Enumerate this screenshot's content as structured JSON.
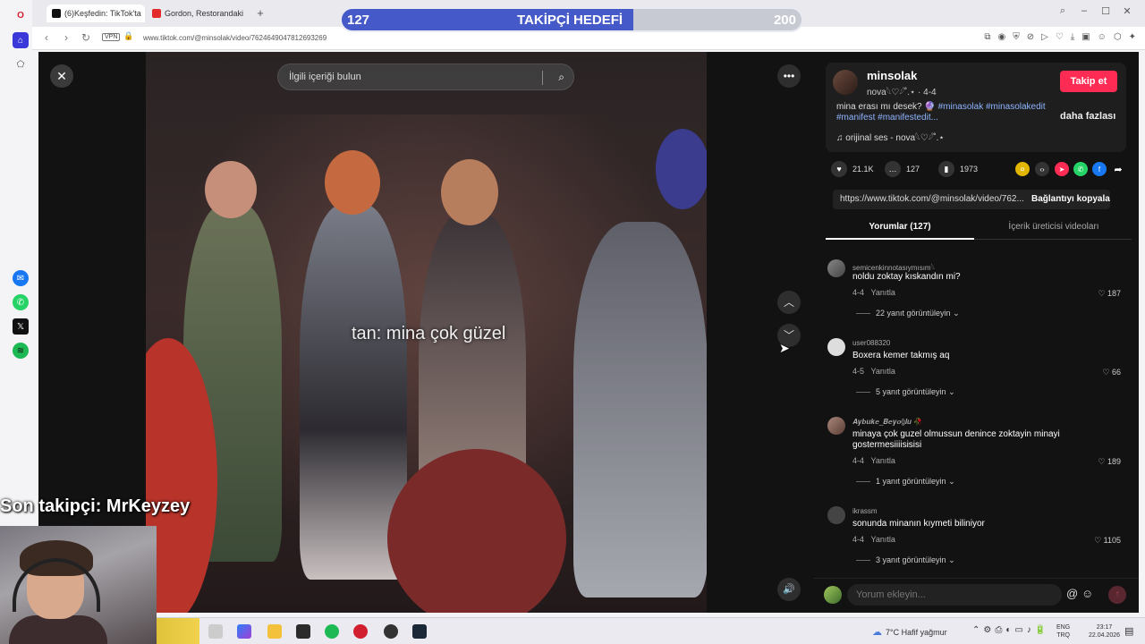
{
  "browser": {
    "tabs": [
      {
        "label": "(6)Keşfedin: TikTok'ta",
        "active": true
      },
      {
        "label": "Gordon, Restorandaki M...",
        "active": false
      }
    ],
    "new_tab": "+",
    "url": "www.tiktok.com/@minsolak/video/7624649047812693269",
    "vpn": "VPN"
  },
  "overlay": {
    "goal_current": "127",
    "goal_label": "TAKİPÇİ HEDEFİ",
    "goal_target": "200",
    "goal_progress": 0.635,
    "last_follower": "Son takipçi: MrKeyzey"
  },
  "video": {
    "search_placeholder": "İlgili içeriği bulun",
    "caption": "tan: mina çok güzel"
  },
  "author": {
    "username": "minsolak",
    "subline": "nova𓆩♡𓆪˚.⋆ · 4-4",
    "follow_label": "Takip et",
    "description_prefix": "mina erası mı desek? 🔮 ",
    "description_tags": "#minasolak #minasolakedit #manifest #manifestedit...",
    "more_label": "daha fazlası",
    "music": "♫  orijinal ses - nova𓆩♡𓆪˚.⋆"
  },
  "stats": {
    "likes": "21.1K",
    "comments": "127",
    "saves": "1973"
  },
  "link": {
    "url": "https://www.tiktok.com/@minsolak/video/762...",
    "copy_label": "Bağlantıyı kopyala"
  },
  "panel_tabs": [
    {
      "label": "Yorumlar (127)",
      "active": true
    },
    {
      "label": "İçerik üreticisi videoları",
      "active": false
    }
  ],
  "comments": [
    {
      "user": "semicenkinnotasıymısım𓆩",
      "text": "noldu zoktay kıskandın mi?",
      "date": "4-4",
      "reply": "Yanıtla",
      "likes": "187",
      "replies": "22 yanıt görüntüleyin"
    },
    {
      "user": "user088320",
      "text": "Boxera kemer takmış aq",
      "date": "4-5",
      "reply": "Yanıtla",
      "likes": "66",
      "replies": "5 yanıt görüntüleyin"
    },
    {
      "user": "𝑨𝒚𝒃𝒖𝒌𝒆_𝑩𝒆𝒚𝒐ğ𝒍𝒖 🥀",
      "text": "minaya çok guzel olmussun denince zoktayin minayi gostermesiiiisisisi",
      "date": "4-4",
      "reply": "Yanıtla",
      "likes": "189",
      "replies": "1 yanıt görüntüleyin"
    },
    {
      "user": "ikrassm",
      "text": "sonunda minanın kıymeti biliniyor",
      "date": "4-4",
      "reply": "Yanıtla",
      "likes": "1105",
      "replies": "3 yanıt görüntüleyin"
    }
  ],
  "comment_input": {
    "placeholder": "Yorum ekleyin..."
  },
  "taskbar": {
    "weather": "7°C  Hafif yağmur",
    "lang_1": "ENG",
    "lang_2": "TRQ",
    "time": "23:17",
    "date": "22.04.2026"
  },
  "colors": {
    "tiktok_red": "#fe2c55",
    "goal_fill": "#4659c8",
    "hashtag": "#8fb4ff"
  }
}
